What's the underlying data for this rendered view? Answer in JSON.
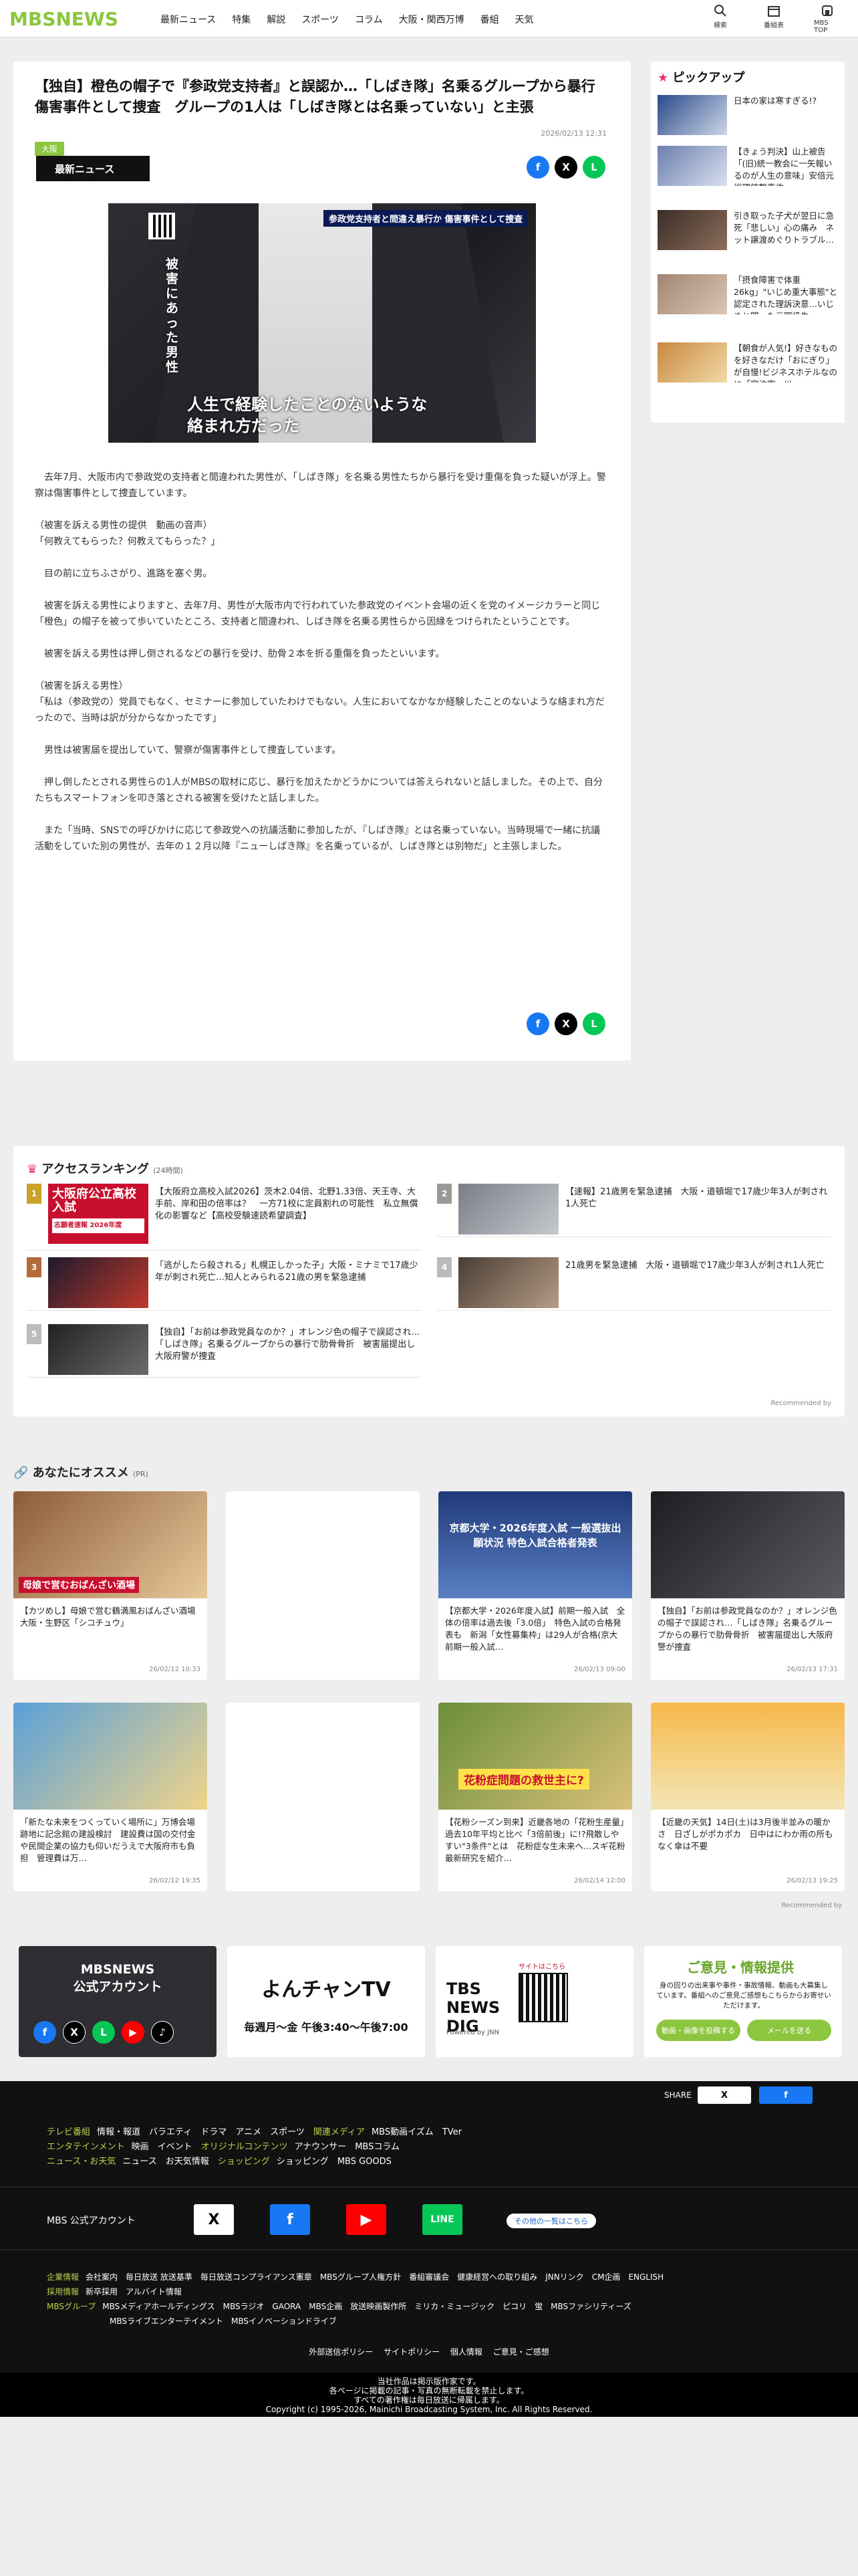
{
  "header": {
    "logo": "MBSNEWS",
    "nav": [
      "最新ニュース",
      "特集",
      "解説",
      "スポーツ",
      "コラム",
      "大阪・関西万博",
      "番組",
      "天気"
    ],
    "tools": [
      {
        "label": "検索",
        "icon": "search-icon"
      },
      {
        "label": "番組表",
        "icon": "calendar-icon"
      },
      {
        "label": "MBS TOP",
        "icon": "home-icon"
      }
    ]
  },
  "article": {
    "headline": "【独自】橙色の帽子で『参政党支持者』と誤認か…「しばき隊」名乗るグループから暴行　傷害事件として捜査　グループの1人は「しばき隊とは名乗っていない」と主張",
    "tag": "大阪",
    "date": "2026/02/13 12:31",
    "section_label": "最新ニュース",
    "image_top_caption": "参政党支持者と間違え暴行か 傷害事件として捜査",
    "image_vertical_caption": "被害にあった男性",
    "image_caption": "人生で経験したことのないような\n絡まれ方だった",
    "paragraphs": [
      "　去年7月、大阪市内で参政党の支持者と間違われた男性が、「しばき隊」を名乗る男性たちから暴行を受け重傷を負った疑いが浮上。警察は傷害事件として捜査しています。",
      "（被害を訴える男性の提供　動画の音声）\n「何教えてもらった？何教えてもらった？」",
      "　目の前に立ちふさがり、進路を塞ぐ男。",
      "　被害を訴える男性によりますと、去年7月、男性が大阪市内で行われていた参政党のイベント会場の近くを党のイメージカラーと同じ「橙色」の帽子を被って歩いていたところ、支持者と間違われ、しばき隊を名乗る男性らから因縁をつけられたということです。",
      "　被害を訴える男性は押し倒されるなどの暴行を受け、肋骨２本を折る重傷を負ったといいます。",
      "（被害を訴える男性）\n「私は（参政党の）党員でもなく、セミナーに参加していたわけでもない。人生においてなかなか経験したことのないような絡まれ方だったので、当時は訳が分からなかったです」",
      "　男性は被害届を提出していて、警察が傷害事件として捜査しています。",
      "　押し倒したとされる男性らの1人がMBSの取材に応じ、暴行を加えたかどうかについては答えられないと話しました。その上で、自分たちもスマートフォンを叩き落とされる被害を受けたと話しました。",
      "　また「当時、SNSでの呼びかけに応じて参政党への抗議活動に参加したが、『しばき隊』とは名乗っていない。当時現場で一緒に抗議活動をしていた別の男性が、去年の１２月以降『ニューしばき隊』を名乗っているが、しばき隊とは別物だ」と主張しました。"
    ]
  },
  "pickup": {
    "title": "ピックアップ",
    "items": [
      "日本の家は寒すぎる!?",
      "【きょう判決】山上被告「(旧)統一教会に一矢報いるのが人生の意味」安倍元総理銃撃事件",
      "引き取った子犬が翌日に急死「悲しい」心の痛み　ネット譲渡めぐりトラブル…",
      "「摂食障害で体重26kg」\"いじめ重大事態\"と認定された理訴決意…いじめと闘った元同級生…",
      "【朝食が人気!】好きなものを好きなだけ「おにぎり」が自慢!ビジネスホテルなのに「宿泊客」以…"
    ]
  },
  "ranking": {
    "title": "アクセスランキング",
    "subtitle": "(24時間)",
    "thumb_text": "大阪府公立高校入試",
    "thumb_sub": "志願者速報 2026年度",
    "items": [
      "【大阪府立高校入試2026】茨木2.04倍、北野1.33倍、天王寺、大手前、岸和田の倍率は？　一方71校に定員割れの可能性　私立無償化の影響など【高校受験速読希望調査】",
      "【速報】21歳男を緊急逮捕　大阪・道頓堀で17歳少年3人が刺され1人死亡",
      "「逃がしたら殺される」札幌正しかった子」大阪・ミナミで17歳少年が刺され死亡…知人とみられる21歳の男を緊急逮捕",
      "21歳男を緊急逮捕　大阪・道頓堀で17歳少年3人が刺され1人死亡",
      "【独自】「お前は参政党員なのか？」オレンジ色の帽子で誤認され…「しばき隊」名乗るグループからの暴行で肋骨骨折　被害届提出し大阪府警が捜査"
    ],
    "footer": "Recommended by"
  },
  "recommend": {
    "title": "あなたにオススメ",
    "subtitle": "(PR)",
    "cards": [
      {
        "text": "【カツめし】母娘で営む鶴満風おばんざい酒場　大阪・生野区「シコチュウ」",
        "date": "26/02/12 10:33",
        "thumb_label": "母娘で営むおばんざい酒場"
      },
      {
        "text": "",
        "date": ""
      },
      {
        "text": "【京都大学・2026年度入試】前期一般入試　全体の倍率は過去後「3.0倍」　特色入試の合格発表も　新潟「女性募集枠」は29人が合格(京大前期一般入試…",
        "date": "26/02/13 09:00",
        "thumb_label": "京都大学・2026年度入試 一般選抜出願状況 特色入試合格者発表"
      },
      {
        "text": "【独自】「お前は参政党員なのか？」オレンジ色の帽子で誤認され…「しばき隊」名乗るグループからの暴行で肋骨骨折　被害届提出し大阪府警が捜査",
        "date": "26/02/13 17:31"
      },
      {
        "text": "「新たな未来をつくっていく場所に」万博会場跡地に記念館の建設検討　建設費は国の交付金や民間企業の協力も仰いだうえで大阪府市も負担　管理費は万…",
        "date": "26/02/12 19:35"
      },
      {
        "text": "",
        "date": ""
      },
      {
        "text": "【花粉シーズン到来】近畿各地の「花粉生産量」過去10年平均と比べ「3倍前後」に!?飛散しやすい\"3条件\"とは　花粉症な生未来へ…スギ花粉最新研究を紹介…",
        "date": "26/02/14 12:00",
        "thumb_label": "花粉症問題の救世主に?"
      },
      {
        "text": "【近畿の天気】14日(土)は3月後半並みの暖かさ　日ざしがポカポカ　日中はにわか雨の所もなく傘は不要",
        "date": "26/02/13 19:25"
      }
    ],
    "footer": "Recommended by"
  },
  "banners": {
    "official": "MBSNEWS\n公式アカウント",
    "yonchan_time": "毎週月〜金 午後3:40〜午後7:00",
    "yonchan_logo": "よんチャンTV",
    "newsdig": "TBS NEWS DIG",
    "newsdig_sub": "Powered by JNN",
    "newsdig_qr": "サイトはこちら",
    "opinion_title": "ご意見・情報提供",
    "opinion_text": "身の回りの出来事や事件・事故情報、動画も大募集しています。番組へのご意見ご感想もこちらからお寄せいただけます。",
    "opinion_btn1": "動画・画像を投稿する",
    "opinion_btn2": "メールを送る"
  },
  "footer": {
    "share_label": "SHARE",
    "rows": [
      {
        "cat": "テレビ番組",
        "items": [
          "情報・報道",
          "バラエティ",
          "ドラマ",
          "アニメ",
          "スポーツ"
        ],
        "cat2": "関連メディア",
        "items2": [
          "MBS動画イズム",
          "TVer"
        ]
      },
      {
        "cat": "エンタテインメント",
        "items": [
          "映画",
          "イベント"
        ],
        "cat2": "オリジナルコンテンツ",
        "items2": [
          "アナウンサー",
          "MBSコラム"
        ]
      },
      {
        "cat": "ニュース・お天気",
        "items": [
          "ニュース",
          "お天気情報"
        ],
        "cat2": "ショッピング",
        "items2": [
          "ショッピング",
          "MBS GOODS"
        ]
      }
    ],
    "official_label": "MBS 公式アカウント",
    "official_more": "その他の一覧はこちら",
    "company_rows": [
      {
        "cat": "企業情報",
        "items": [
          "会社案内",
          "毎日放送 放送基準",
          "毎日放送コンプライアンス憲章",
          "MBSグループ人権方針",
          "番組審議会",
          "健康経営への取り組み",
          "JNNリンク",
          "CM企画",
          "ENGLISH"
        ]
      },
      {
        "cat": "採用情報",
        "items": [
          "新卒採用",
          "アルバイト情報"
        ]
      },
      {
        "cat": "MBSグループ",
        "items": [
          "MBSメディアホールディングス",
          "MBSラジオ",
          "GAORA",
          "MBS企画",
          "放送映画製作所",
          "ミリカ・ミュージック",
          "ピコリ",
          "蛍",
          "MBSファシリティーズ"
        ]
      },
      {
        "cat": "",
        "items": [
          "MBSライブエンターテイメント",
          "MBSイノベーションドライブ"
        ]
      }
    ],
    "policy_links": [
      "外部送信ポリシー",
      "サイトポリシー",
      "個人情報",
      "ご意見・ご感想"
    ],
    "copyright_lines": [
      "当社作品は掲示版作家です。",
      "各ページに掲載の記事・写真の無断転載を禁止します。",
      "すべての著作権は毎日放送に帰属します。",
      "Copyright (c) 1995-2026, Mainichi Broadcasting System, Inc. All Rights Reserved."
    ]
  },
  "colors": {
    "brand_green": "#8cc63f",
    "footer_bg": "#111111",
    "rank_gold": "#c9a227"
  }
}
